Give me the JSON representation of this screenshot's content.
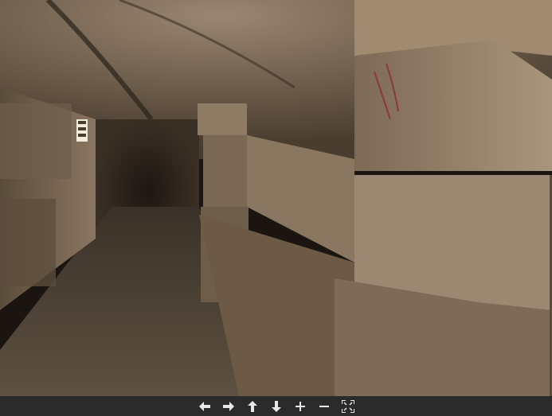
{
  "scene": {
    "description_icon": "panorama-viewport"
  },
  "controls": [
    {
      "name": "pan-left-button",
      "icon": "arrow-left-icon"
    },
    {
      "name": "pan-right-button",
      "icon": "arrow-right-icon"
    },
    {
      "name": "pan-up-button",
      "icon": "arrow-up-icon"
    },
    {
      "name": "pan-down-button",
      "icon": "arrow-down-icon"
    },
    {
      "name": "zoom-in-button",
      "icon": "plus-icon"
    },
    {
      "name": "zoom-out-button",
      "icon": "minus-icon"
    },
    {
      "name": "fullscreen-button",
      "icon": "fullscreen-icon"
    }
  ],
  "colors": {
    "control_bar": "#2b2b2b",
    "control_icon": "#e8e8e8"
  }
}
